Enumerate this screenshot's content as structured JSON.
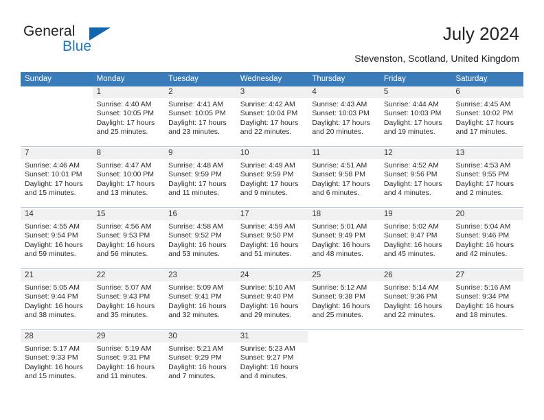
{
  "brand": {
    "name_part1": "General",
    "name_part2": "Blue",
    "triangle_icon": "blue-triangle-icon",
    "accent_color": "#1266ad",
    "text_color": "#231f20"
  },
  "header": {
    "title": "July 2024",
    "subtitle": "Stevenston, Scotland, United Kingdom"
  },
  "calendar": {
    "header_bg": "#3a7cb9",
    "daynum_bg": "#f0f0f0",
    "separator_color": "#b9cbdd",
    "weekdays": [
      "Sunday",
      "Monday",
      "Tuesday",
      "Wednesday",
      "Thursday",
      "Friday",
      "Saturday"
    ],
    "weeks": [
      {
        "days": [
          {
            "num": "",
            "sunrise": "",
            "sunset": "",
            "daylight_l1": "",
            "daylight_l2": ""
          },
          {
            "num": "1",
            "sunrise": "Sunrise: 4:40 AM",
            "sunset": "Sunset: 10:05 PM",
            "daylight_l1": "Daylight: 17 hours",
            "daylight_l2": "and 25 minutes."
          },
          {
            "num": "2",
            "sunrise": "Sunrise: 4:41 AM",
            "sunset": "Sunset: 10:05 PM",
            "daylight_l1": "Daylight: 17 hours",
            "daylight_l2": "and 23 minutes."
          },
          {
            "num": "3",
            "sunrise": "Sunrise: 4:42 AM",
            "sunset": "Sunset: 10:04 PM",
            "daylight_l1": "Daylight: 17 hours",
            "daylight_l2": "and 22 minutes."
          },
          {
            "num": "4",
            "sunrise": "Sunrise: 4:43 AM",
            "sunset": "Sunset: 10:03 PM",
            "daylight_l1": "Daylight: 17 hours",
            "daylight_l2": "and 20 minutes."
          },
          {
            "num": "5",
            "sunrise": "Sunrise: 4:44 AM",
            "sunset": "Sunset: 10:03 PM",
            "daylight_l1": "Daylight: 17 hours",
            "daylight_l2": "and 19 minutes."
          },
          {
            "num": "6",
            "sunrise": "Sunrise: 4:45 AM",
            "sunset": "Sunset: 10:02 PM",
            "daylight_l1": "Daylight: 17 hours",
            "daylight_l2": "and 17 minutes."
          }
        ]
      },
      {
        "days": [
          {
            "num": "7",
            "sunrise": "Sunrise: 4:46 AM",
            "sunset": "Sunset: 10:01 PM",
            "daylight_l1": "Daylight: 17 hours",
            "daylight_l2": "and 15 minutes."
          },
          {
            "num": "8",
            "sunrise": "Sunrise: 4:47 AM",
            "sunset": "Sunset: 10:00 PM",
            "daylight_l1": "Daylight: 17 hours",
            "daylight_l2": "and 13 minutes."
          },
          {
            "num": "9",
            "sunrise": "Sunrise: 4:48 AM",
            "sunset": "Sunset: 9:59 PM",
            "daylight_l1": "Daylight: 17 hours",
            "daylight_l2": "and 11 minutes."
          },
          {
            "num": "10",
            "sunrise": "Sunrise: 4:49 AM",
            "sunset": "Sunset: 9:59 PM",
            "daylight_l1": "Daylight: 17 hours",
            "daylight_l2": "and 9 minutes."
          },
          {
            "num": "11",
            "sunrise": "Sunrise: 4:51 AM",
            "sunset": "Sunset: 9:58 PM",
            "daylight_l1": "Daylight: 17 hours",
            "daylight_l2": "and 6 minutes."
          },
          {
            "num": "12",
            "sunrise": "Sunrise: 4:52 AM",
            "sunset": "Sunset: 9:56 PM",
            "daylight_l1": "Daylight: 17 hours",
            "daylight_l2": "and 4 minutes."
          },
          {
            "num": "13",
            "sunrise": "Sunrise: 4:53 AM",
            "sunset": "Sunset: 9:55 PM",
            "daylight_l1": "Daylight: 17 hours",
            "daylight_l2": "and 2 minutes."
          }
        ]
      },
      {
        "days": [
          {
            "num": "14",
            "sunrise": "Sunrise: 4:55 AM",
            "sunset": "Sunset: 9:54 PM",
            "daylight_l1": "Daylight: 16 hours",
            "daylight_l2": "and 59 minutes."
          },
          {
            "num": "15",
            "sunrise": "Sunrise: 4:56 AM",
            "sunset": "Sunset: 9:53 PM",
            "daylight_l1": "Daylight: 16 hours",
            "daylight_l2": "and 56 minutes."
          },
          {
            "num": "16",
            "sunrise": "Sunrise: 4:58 AM",
            "sunset": "Sunset: 9:52 PM",
            "daylight_l1": "Daylight: 16 hours",
            "daylight_l2": "and 53 minutes."
          },
          {
            "num": "17",
            "sunrise": "Sunrise: 4:59 AM",
            "sunset": "Sunset: 9:50 PM",
            "daylight_l1": "Daylight: 16 hours",
            "daylight_l2": "and 51 minutes."
          },
          {
            "num": "18",
            "sunrise": "Sunrise: 5:01 AM",
            "sunset": "Sunset: 9:49 PM",
            "daylight_l1": "Daylight: 16 hours",
            "daylight_l2": "and 48 minutes."
          },
          {
            "num": "19",
            "sunrise": "Sunrise: 5:02 AM",
            "sunset": "Sunset: 9:47 PM",
            "daylight_l1": "Daylight: 16 hours",
            "daylight_l2": "and 45 minutes."
          },
          {
            "num": "20",
            "sunrise": "Sunrise: 5:04 AM",
            "sunset": "Sunset: 9:46 PM",
            "daylight_l1": "Daylight: 16 hours",
            "daylight_l2": "and 42 minutes."
          }
        ]
      },
      {
        "days": [
          {
            "num": "21",
            "sunrise": "Sunrise: 5:05 AM",
            "sunset": "Sunset: 9:44 PM",
            "daylight_l1": "Daylight: 16 hours",
            "daylight_l2": "and 38 minutes."
          },
          {
            "num": "22",
            "sunrise": "Sunrise: 5:07 AM",
            "sunset": "Sunset: 9:43 PM",
            "daylight_l1": "Daylight: 16 hours",
            "daylight_l2": "and 35 minutes."
          },
          {
            "num": "23",
            "sunrise": "Sunrise: 5:09 AM",
            "sunset": "Sunset: 9:41 PM",
            "daylight_l1": "Daylight: 16 hours",
            "daylight_l2": "and 32 minutes."
          },
          {
            "num": "24",
            "sunrise": "Sunrise: 5:10 AM",
            "sunset": "Sunset: 9:40 PM",
            "daylight_l1": "Daylight: 16 hours",
            "daylight_l2": "and 29 minutes."
          },
          {
            "num": "25",
            "sunrise": "Sunrise: 5:12 AM",
            "sunset": "Sunset: 9:38 PM",
            "daylight_l1": "Daylight: 16 hours",
            "daylight_l2": "and 25 minutes."
          },
          {
            "num": "26",
            "sunrise": "Sunrise: 5:14 AM",
            "sunset": "Sunset: 9:36 PM",
            "daylight_l1": "Daylight: 16 hours",
            "daylight_l2": "and 22 minutes."
          },
          {
            "num": "27",
            "sunrise": "Sunrise: 5:16 AM",
            "sunset": "Sunset: 9:34 PM",
            "daylight_l1": "Daylight: 16 hours",
            "daylight_l2": "and 18 minutes."
          }
        ]
      },
      {
        "days": [
          {
            "num": "28",
            "sunrise": "Sunrise: 5:17 AM",
            "sunset": "Sunset: 9:33 PM",
            "daylight_l1": "Daylight: 16 hours",
            "daylight_l2": "and 15 minutes."
          },
          {
            "num": "29",
            "sunrise": "Sunrise: 5:19 AM",
            "sunset": "Sunset: 9:31 PM",
            "daylight_l1": "Daylight: 16 hours",
            "daylight_l2": "and 11 minutes."
          },
          {
            "num": "30",
            "sunrise": "Sunrise: 5:21 AM",
            "sunset": "Sunset: 9:29 PM",
            "daylight_l1": "Daylight: 16 hours",
            "daylight_l2": "and 7 minutes."
          },
          {
            "num": "31",
            "sunrise": "Sunrise: 5:23 AM",
            "sunset": "Sunset: 9:27 PM",
            "daylight_l1": "Daylight: 16 hours",
            "daylight_l2": "and 4 minutes."
          },
          {
            "num": "",
            "sunrise": "",
            "sunset": "",
            "daylight_l1": "",
            "daylight_l2": ""
          },
          {
            "num": "",
            "sunrise": "",
            "sunset": "",
            "daylight_l1": "",
            "daylight_l2": ""
          },
          {
            "num": "",
            "sunrise": "",
            "sunset": "",
            "daylight_l1": "",
            "daylight_l2": ""
          }
        ]
      }
    ]
  }
}
